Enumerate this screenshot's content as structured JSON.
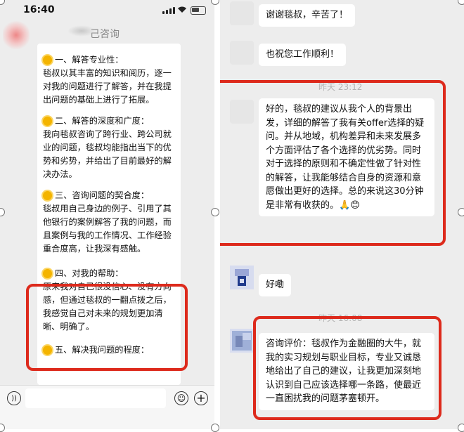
{
  "left": {
    "status_time": "16:40",
    "header_title": "己咨询",
    "back_symbol": "‹",
    "sections": [
      {
        "heading": "一、解答专业性：",
        "body": "毯叔以其丰富的知识和阅历，逐一对我的问题进行了解答，并在我提出问题的基础上进行了拓展。"
      },
      {
        "heading": "二、解答的深度和广度：",
        "body": "我向毯叔咨询了跨行业、跨公司就业的问题，毯叔均能指出当下的优势和劣势，并给出了目前最好的解决办法。"
      },
      {
        "heading": "三、咨询问题的契合度：",
        "body": "毯叔用自己身边的例子、引用了其他银行的案例解答了我的问题，而且案例与我的工作情况、工作经验重合度高，让我深有感触。"
      },
      {
        "heading": "四、对我的帮助：",
        "body": "原来我对自己很没信心、没有方向感，但通过毯叔的一翻点拨之后，我感觉自己对未来的规划更加清晰、明确了。"
      },
      {
        "heading": "五、解决我问题的程度：",
        "body": ""
      }
    ],
    "input_icons": {
      "voice": "voice-icon",
      "emoji": "emoji-icon",
      "plus": "plus-icon"
    }
  },
  "right": {
    "msg1": "谢谢毯叔，辛苦了！",
    "msg2": "也祝您工作顺利！",
    "timestamp1": "昨天 23:12",
    "msg3": "好的，毯叔的建议从我个人的背景出发，详细的解答了我有关offer选择的疑问。并从地域，机构差异和未来发展多个方面评估了各个选择的优劣势。同时对于选择的原则和不确定性做了针对性的解答，让我能够结合自身的资源和意愿做出更好的选择。总的来说这30分钟是非常有收获的。",
    "msg3_emoji": "🙏😊",
    "msg4": "好嘞",
    "timestamp2": "昨天 16:08",
    "msg5": "咨询评价：毯叔作为金融圈的大牛，就我的实习规划与职业目标，专业又诚恳地给出了自己的建议，让我更加深刻地认识到自己应该选择哪一条路，使最近一直困扰我的问题茅塞顿开。"
  },
  "colors": {
    "highlight": "#dd2a1c",
    "chat_bg": "#ededed",
    "bubble": "#ffffff"
  }
}
